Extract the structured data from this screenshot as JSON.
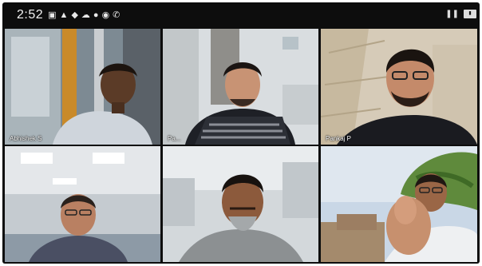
{
  "status_bar": {
    "time": "2:52",
    "icons": [
      "gallery-icon",
      "warning-icon",
      "android-icon",
      "cloud-icon",
      "mic-icon",
      "chat-icon",
      "phone-icon"
    ],
    "right_icons": [
      "pause-icon",
      "battery-icon"
    ]
  },
  "participants": [
    {
      "name": "Abhishek S"
    },
    {
      "name": "Pa..."
    },
    {
      "name": "Pankaj P"
    },
    {
      "name": ""
    },
    {
      "name": ""
    },
    {
      "name": ""
    }
  ]
}
